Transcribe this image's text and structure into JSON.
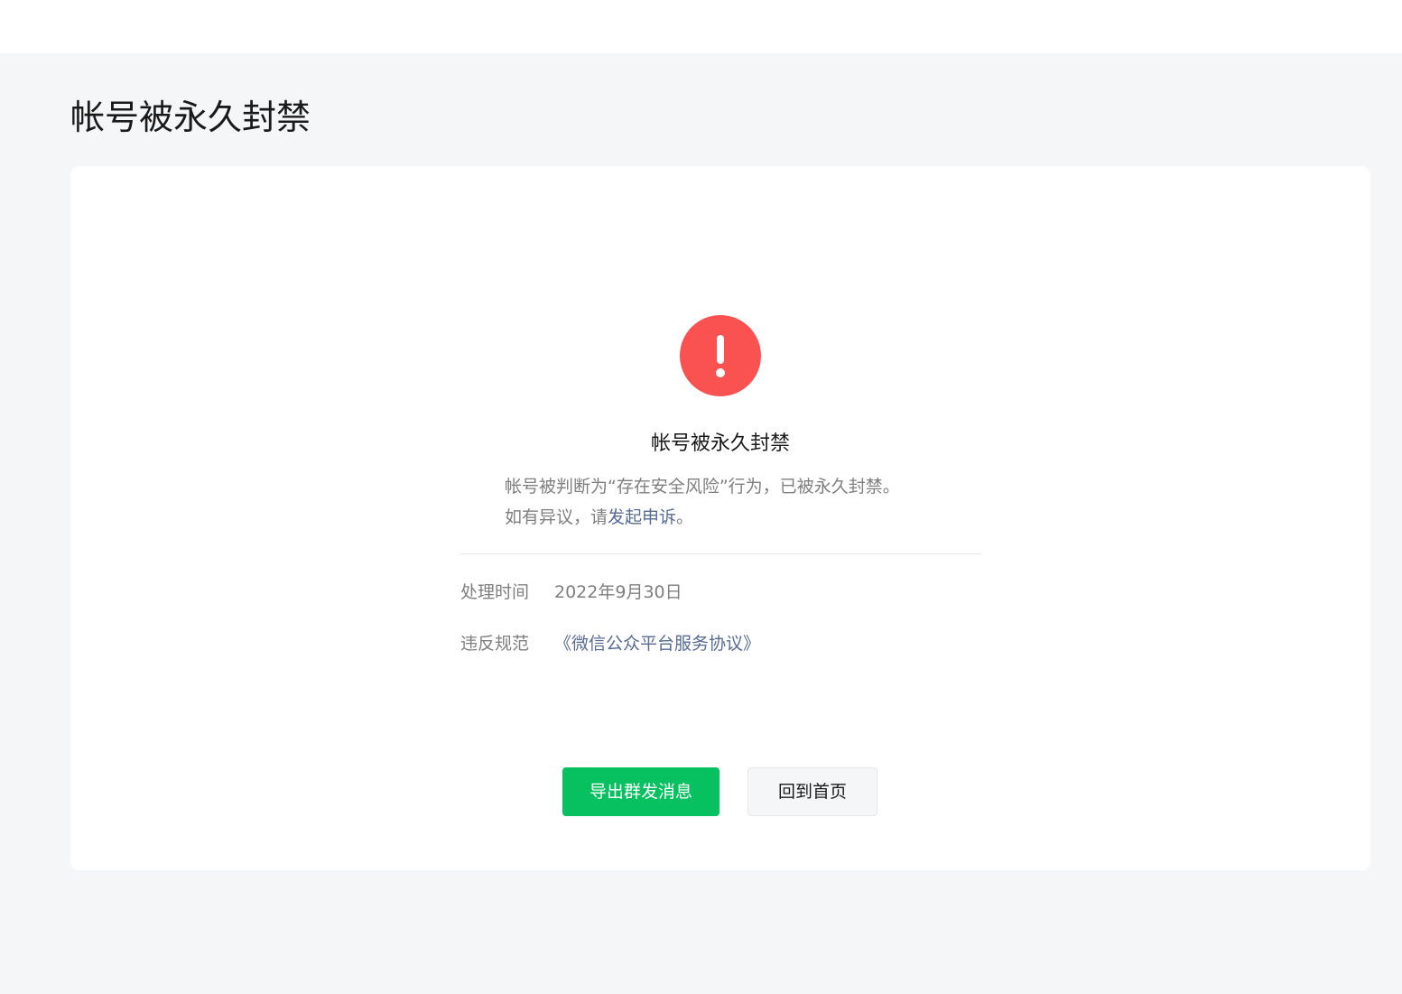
{
  "page": {
    "title": "帐号被永久封禁"
  },
  "result": {
    "icon": "warning-icon",
    "icon_color": "#fa5151",
    "title": "帐号被永久封禁",
    "desc_line1": "帐号被判断为“存在安全风险”行为，已被永久封禁。",
    "desc_line2_prefix": "如有异议，请",
    "desc_link": "发起申诉",
    "desc_line2_suffix": "。"
  },
  "info": {
    "time_label": "处理时间",
    "time_value": "2022年9月30日",
    "rule_label": "违反规范",
    "rule_value": "《微信公众平台服务协议》"
  },
  "actions": {
    "primary_label": "导出群发消息",
    "primary_color": "#07c160",
    "secondary_label": "回到首页"
  },
  "colors": {
    "link": "#576b95",
    "background": "#f5f6f7"
  }
}
